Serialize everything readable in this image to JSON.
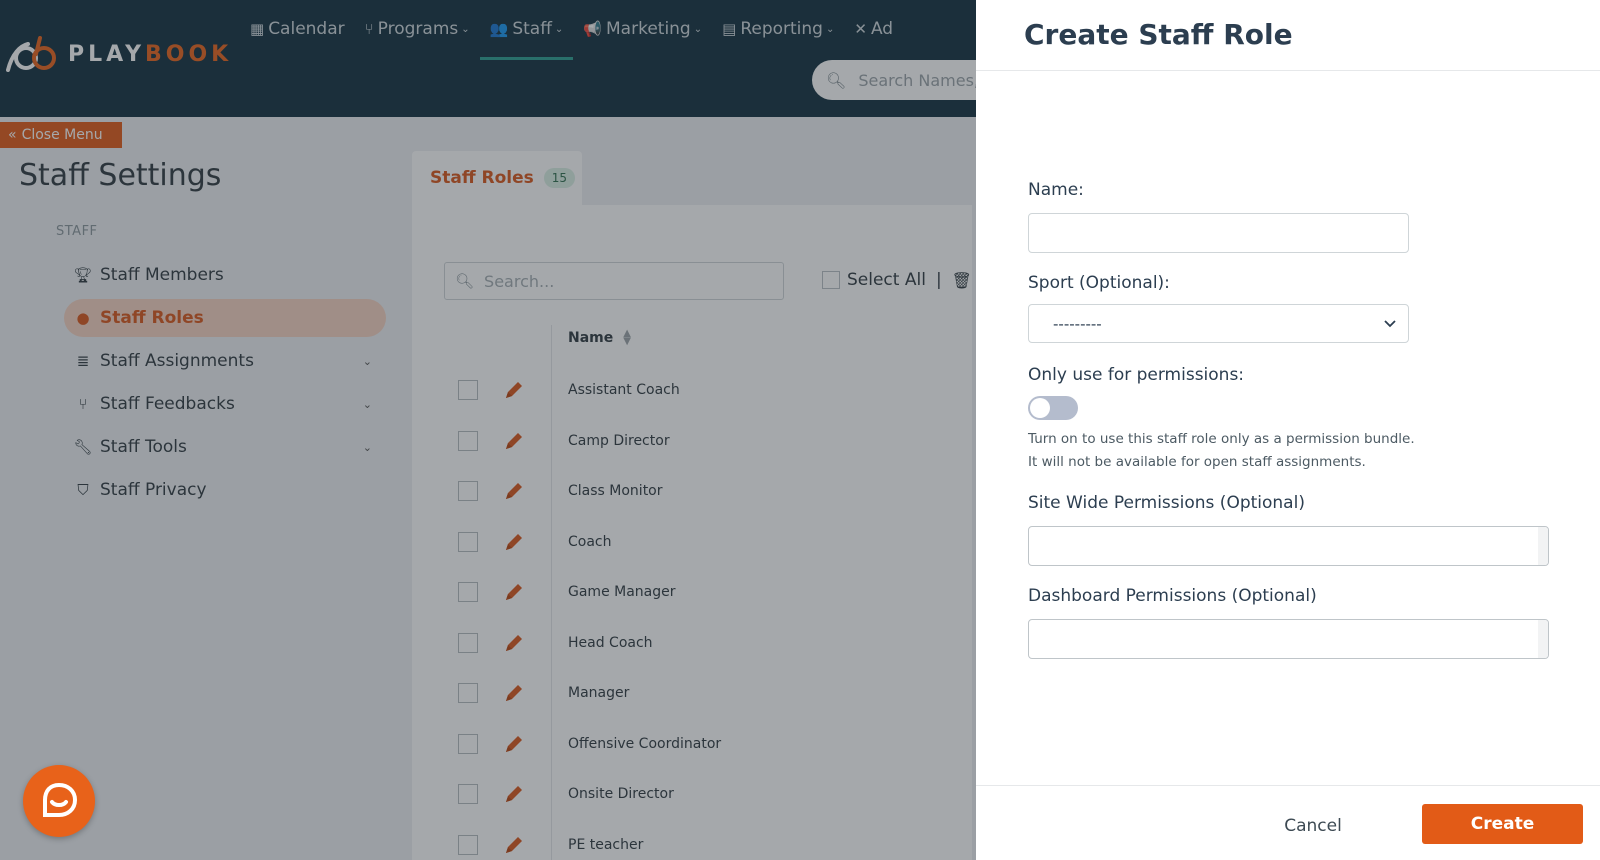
{
  "brand": {
    "logo_play": "PLAY",
    "logo_book": "BOOK"
  },
  "nav": {
    "items": [
      {
        "label": "Calendar"
      },
      {
        "label": "Programs"
      },
      {
        "label": "Staff"
      },
      {
        "label": "Marketing"
      },
      {
        "label": "Reporting"
      },
      {
        "label": "Ad"
      }
    ],
    "search_placeholder": "Search Names,"
  },
  "sidebar": {
    "close_menu_label": "Close Menu",
    "title": "Staff Settings",
    "section": "STAFF",
    "items": [
      {
        "label": "Staff Members"
      },
      {
        "label": "Staff Roles"
      },
      {
        "label": "Staff Assignments"
      },
      {
        "label": "Staff Feedbacks"
      },
      {
        "label": "Staff Tools"
      },
      {
        "label": "Staff Privacy"
      }
    ]
  },
  "main": {
    "tab_label": "Staff Roles",
    "tab_count": "15",
    "search_placeholder": "Search...",
    "select_all_label": "Select All",
    "separator": "|",
    "column_name": "Name",
    "rows": [
      "Assistant Coach",
      "Camp Director",
      "Class Monitor",
      "Coach",
      "Game Manager",
      "Head Coach",
      "Manager",
      "Offensive Coordinator",
      "Onsite Director",
      "PE teacher"
    ]
  },
  "drawer": {
    "title": "Create Staff Role",
    "name_label": "Name:",
    "name_value": "",
    "sport_label": "Sport (Optional):",
    "sport_value": "---------",
    "permissions_only_label": "Only use for permissions:",
    "permissions_only_on": false,
    "help_line1": "Turn on to use this staff role only as a permission bundle.",
    "help_line2": "It will not be available for open staff assignments.",
    "site_wide_label": "Site Wide Permissions (Optional)",
    "dashboard_label": "Dashboard Permissions (Optional)",
    "cancel_label": "Cancel",
    "create_label": "Create"
  },
  "colors": {
    "navbar": "#12303e",
    "accent": "#e25b17",
    "active_tab_underline": "#2a9d8f",
    "badge_bg": "#d9efe4"
  }
}
